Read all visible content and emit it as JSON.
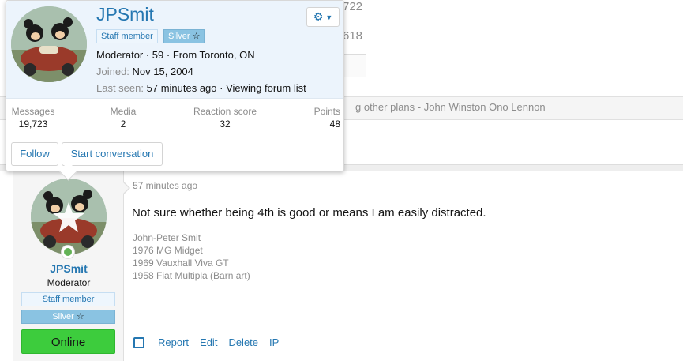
{
  "background": {
    "stat_partial_1": "722",
    "stat_partial_2": "618",
    "quote_text": "g other plans - John Winston Ono Lennon"
  },
  "tooltip": {
    "username": "JPSmit",
    "badges": {
      "staff": "Staff member",
      "silver": "Silver",
      "silver_icon": "☆"
    },
    "info_line": "Moderator · 59 · From Toronto, ON",
    "joined_label": "Joined:",
    "joined_value": "Nov 15, 2004",
    "last_seen_label": "Last seen:",
    "last_seen_value": "57 minutes ago · Viewing forum list",
    "gear_icon": "gear-icon",
    "stats": {
      "messages_label": "Messages",
      "messages_value": "19,723",
      "media_label": "Media",
      "media_value": "2",
      "reaction_label": "Reaction score",
      "reaction_value": "32",
      "points_label": "Points",
      "points_value": "48"
    },
    "buttons": {
      "follow": "Follow",
      "start_conversation": "Start conversation"
    }
  },
  "post": {
    "username": "JPSmit",
    "user_title": "Moderator",
    "banner_staff": "Staff member",
    "banner_silver": "Silver",
    "banner_silver_icon": "☆",
    "banner_online": "Online",
    "time": "57 minutes ago",
    "body": "Not sure whether being 4th is good or means I am easily distracted.",
    "signature": [
      "John-Peter Smit",
      "1976 MG Midget",
      "1969 Vauxhall Viva GT",
      "1958 Fiat Multipla (Barn art)"
    ],
    "actions": {
      "report": "Report",
      "edit": "Edit",
      "delete": "Delete",
      "ip": "IP"
    }
  },
  "colors": {
    "link": "#2577b1",
    "tooltip_header": "#ecf4fc",
    "silver_banner": "#8ac3e2",
    "online_banner": "#3dcc3d",
    "online_dot": "#63b256"
  }
}
